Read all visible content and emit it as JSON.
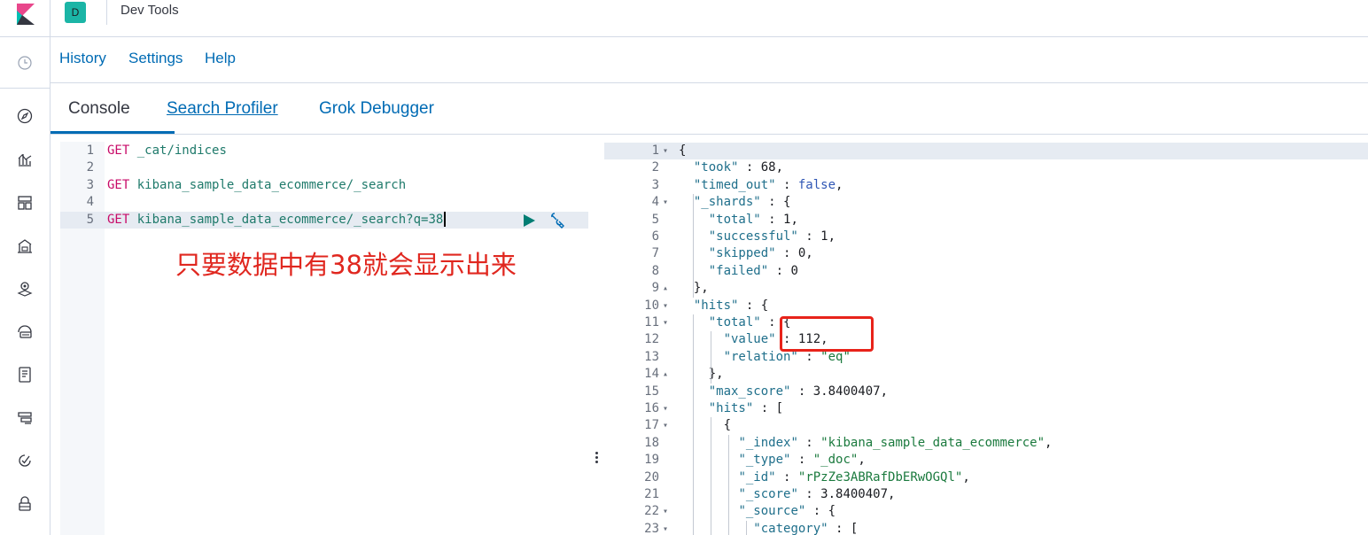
{
  "header": {
    "space_initial": "D",
    "title": "Dev Tools"
  },
  "topmenu": {
    "history": "History",
    "settings": "Settings",
    "help": "Help"
  },
  "tabs": {
    "console": "Console",
    "search_profiler": "Search Profiler",
    "grok_debugger": "Grok Debugger"
  },
  "rail_icons": [
    "clock-icon",
    "compass-icon",
    "visualize-icon",
    "dashboard-icon",
    "canvas-icon",
    "maps-icon",
    "ml-icon",
    "logs-icon",
    "apm-icon",
    "uptime-icon",
    "security-icon"
  ],
  "editor": {
    "lines": [
      {
        "num": "1",
        "method": "GET",
        "path": " _cat/indices"
      },
      {
        "num": "2",
        "method": "",
        "path": ""
      },
      {
        "num": "3",
        "method": "GET",
        "path": " kibana_sample_data_ecommerce/_search"
      },
      {
        "num": "4",
        "method": "",
        "path": ""
      },
      {
        "num": "5",
        "method": "GET",
        "path": " kibana_sample_data_ecommerce/_search?q=38"
      }
    ],
    "annotation": "只要数据中有38就会显示出来"
  },
  "output": {
    "lines": [
      {
        "num": "1",
        "fold": "▾",
        "text": "{"
      },
      {
        "num": "2",
        "fold": "",
        "text": "  \"took\" : 68,"
      },
      {
        "num": "3",
        "fold": "",
        "text": "  \"timed_out\" : false,"
      },
      {
        "num": "4",
        "fold": "▾",
        "text": "  \"_shards\" : {"
      },
      {
        "num": "5",
        "fold": "",
        "text": "    \"total\" : 1,"
      },
      {
        "num": "6",
        "fold": "",
        "text": "    \"successful\" : 1,"
      },
      {
        "num": "7",
        "fold": "",
        "text": "    \"skipped\" : 0,"
      },
      {
        "num": "8",
        "fold": "",
        "text": "    \"failed\" : 0"
      },
      {
        "num": "9",
        "fold": "▴",
        "text": "  },"
      },
      {
        "num": "10",
        "fold": "▾",
        "text": "  \"hits\" : {"
      },
      {
        "num": "11",
        "fold": "▾",
        "text": "    \"total\" : {"
      },
      {
        "num": "12",
        "fold": "",
        "text": "      \"value\" : 112,"
      },
      {
        "num": "13",
        "fold": "",
        "text": "      \"relation\" : \"eq\""
      },
      {
        "num": "14",
        "fold": "▴",
        "text": "    },"
      },
      {
        "num": "15",
        "fold": "",
        "text": "    \"max_score\" : 3.8400407,"
      },
      {
        "num": "16",
        "fold": "▾",
        "text": "    \"hits\" : ["
      },
      {
        "num": "17",
        "fold": "▾",
        "text": "      {"
      },
      {
        "num": "18",
        "fold": "",
        "text": "        \"_index\" : \"kibana_sample_data_ecommerce\","
      },
      {
        "num": "19",
        "fold": "",
        "text": "        \"_type\" : \"_doc\","
      },
      {
        "num": "20",
        "fold": "",
        "text": "        \"_id\" : \"rPzZe3ABRafDbERwOGQl\","
      },
      {
        "num": "21",
        "fold": "",
        "text": "        \"_score\" : 3.8400407,"
      },
      {
        "num": "22",
        "fold": "▾",
        "text": "        \"_source\" : {"
      },
      {
        "num": "23",
        "fold": "▾",
        "text": "          \"category\" : ["
      }
    ]
  },
  "colors": {
    "accent": "#006bb4",
    "annotation": "#e0271f",
    "space_badge": "#1bb5a6"
  }
}
